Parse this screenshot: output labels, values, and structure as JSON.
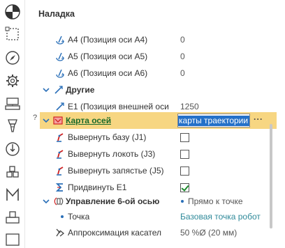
{
  "panel": {
    "title": "Наладка"
  },
  "rows": {
    "a4": {
      "name": "А4 (Позиция оси А4)",
      "value": "0"
    },
    "a5": {
      "name": "А5 (Позиция оси А5)",
      "value": "0"
    },
    "a6": {
      "name": "А6 (Позиция оси А6)",
      "value": "0"
    },
    "other": {
      "name": "Другие"
    },
    "e1": {
      "name": "Е1 (Позиция внешней оси",
      "value": "1250"
    },
    "axis_map": {
      "name": "Карта осей",
      "edit_value": "карты траектории",
      "more": "···",
      "hint": "?"
    },
    "flip_base": {
      "name": "Вывернуть базу (J1)",
      "checked": false
    },
    "flip_elbow": {
      "name": "Вывернуть локоть (J3)",
      "checked": false
    },
    "flip_wrist": {
      "name": "Вывернуть запястье (J5)",
      "checked": false
    },
    "shift_e1": {
      "name": "Придвинуть Е1",
      "checked": true
    },
    "axis6": {
      "name": "Управление 6-ой осью",
      "value": "Прямо к точке"
    },
    "point": {
      "name": "Точка",
      "value": "Базовая точка робот"
    },
    "approx": {
      "name": "Аппроксимация касател",
      "value": "50 %Ø (20 мм)"
    }
  },
  "colors": {
    "selected_bg": "#f7d682",
    "link_green": "#1a6a2a",
    "value_teal": "#2f8a9a",
    "icon_blue": "#2a6fb8",
    "icon_red": "#d02020"
  }
}
